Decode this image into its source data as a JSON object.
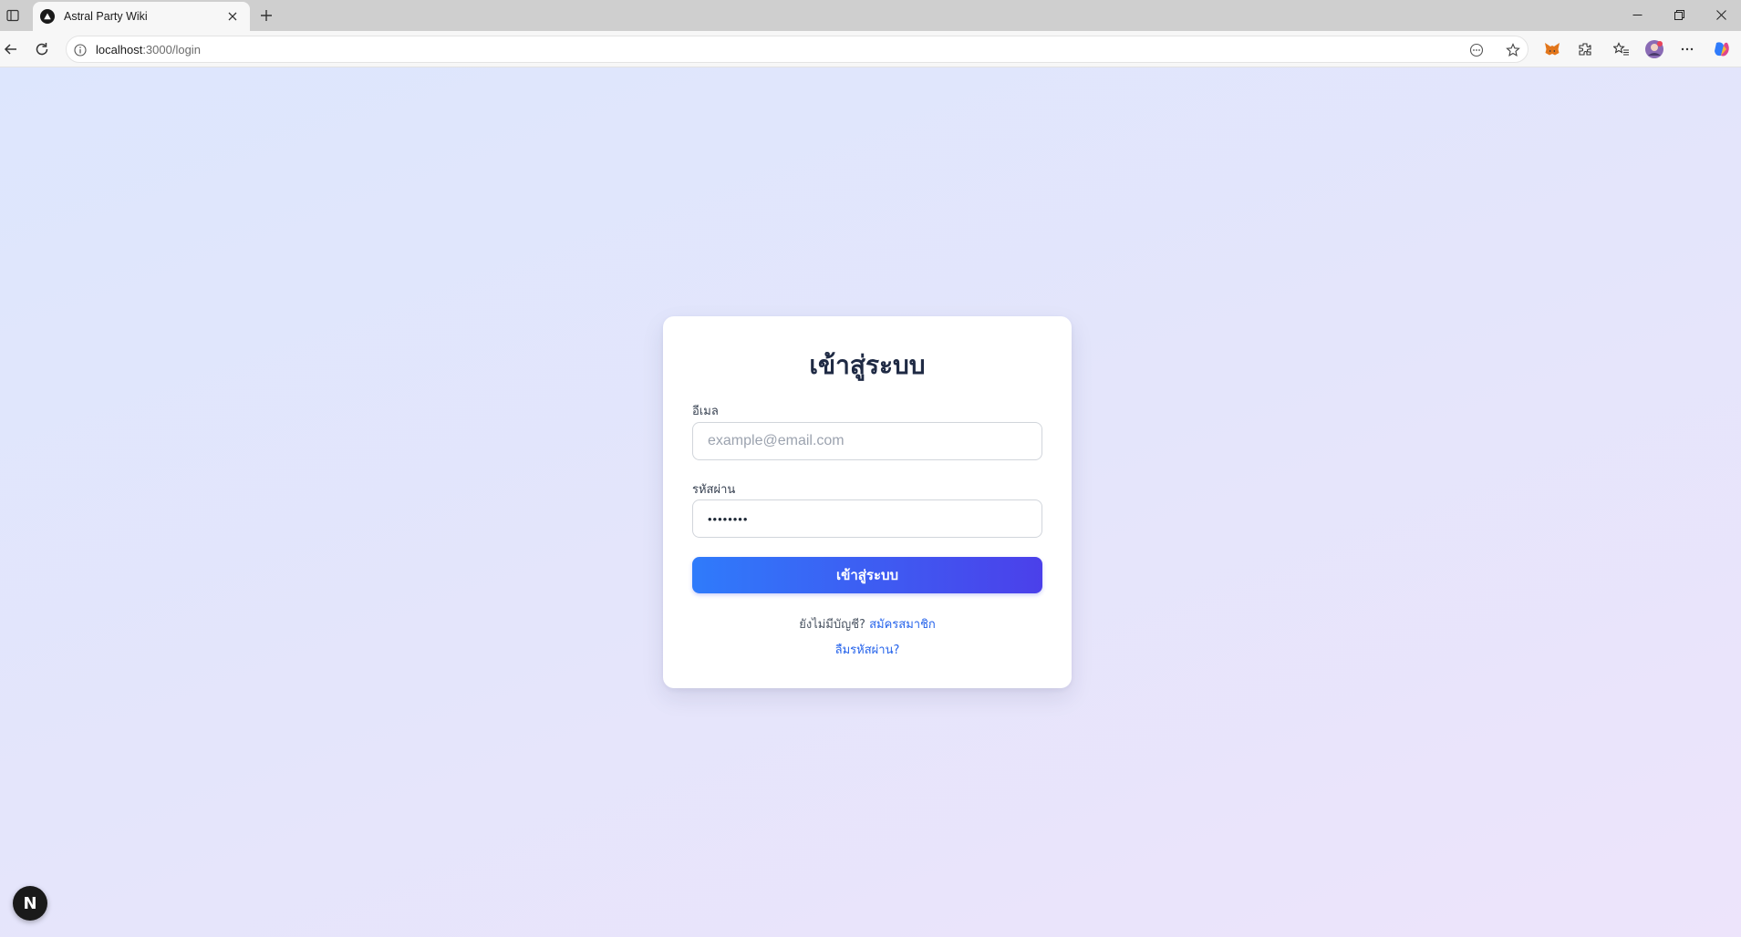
{
  "browser": {
    "tab_title": "Astral Party Wiki",
    "url_host": "localhost",
    "url_rest": ":3000/login"
  },
  "login": {
    "title": "เข้าสู่ระบบ",
    "email_label": "อีเมล",
    "email_placeholder": "example@email.com",
    "password_label": "รหัสผ่าน",
    "password_value": "••••••••",
    "submit_label": "เข้าสู่ระบบ",
    "no_account_text": "ยังไม่มีบัญชี?",
    "signup_link": "สมัครสมาชิก",
    "forgot_link": "ลืมรหัสผ่าน?"
  },
  "dev_badge": {
    "letter": "N"
  },
  "colors": {
    "button_gradient_start": "#2f7bfb",
    "button_gradient_end": "#4b40ea",
    "link": "#2563eb",
    "title": "#1f2a44"
  }
}
